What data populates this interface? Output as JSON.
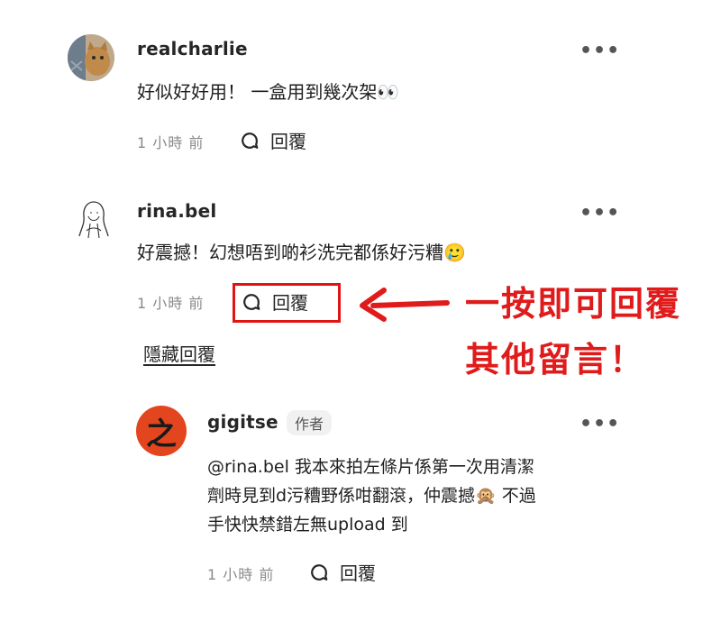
{
  "comments": [
    {
      "username": "realcharlie",
      "text": "好似好好用！ 一盒用到幾次架👀",
      "time": "1 小時 前",
      "reply_label": "回覆"
    },
    {
      "username": "rina.bel",
      "text": "好震撼！幻想唔到啲衫洗完都係好污糟🥲",
      "time": "1 小時 前",
      "reply_label": "回覆",
      "hide_replies_label": "隱藏回覆"
    }
  ],
  "reply": {
    "username": "gigitse",
    "badge": "作者",
    "avatar_char": "之",
    "lines": [
      "@rina.bel 我本來拍左條片係第一次用清潔",
      "劑時見到d污糟野係咁翻滾，仲震撼🙊 不過",
      "手快快禁錯左無upload 到"
    ],
    "time": "1 小時 前",
    "reply_label": "回覆"
  },
  "more_label": "•••",
  "annotation": {
    "line1": "一按即可回覆",
    "line2": "其他留言！",
    "color": "#e01b1b"
  },
  "icons": {
    "reply": "speech-bubble-icon",
    "more": "more-options-icon"
  }
}
